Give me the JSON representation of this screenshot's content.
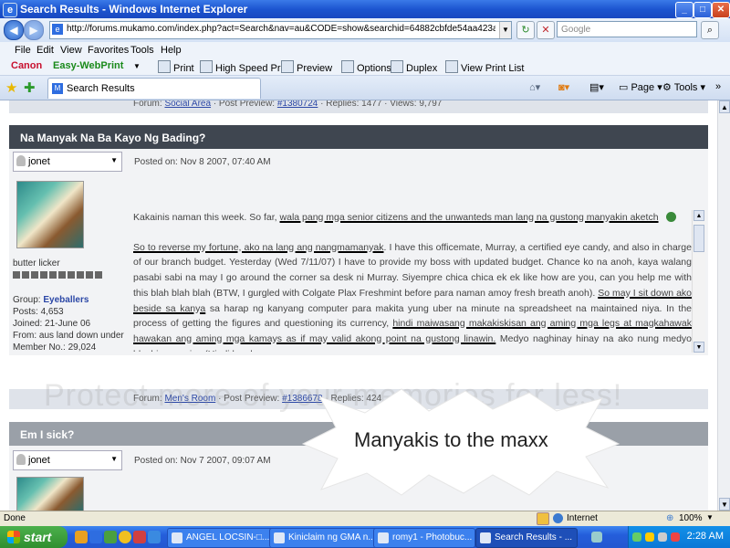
{
  "window": {
    "title": "Search Results - Windows Internet Explorer",
    "minimize": "_",
    "maximize": "□",
    "close": "✕"
  },
  "address": {
    "url": "http://forums.mukamo.com/index.php?act=Search&nav=au&CODE=show&searchid=64882cbfde54aa423ab0834bec87c23",
    "search_placeholder": "Google"
  },
  "menu": [
    "File",
    "Edit",
    "View",
    "Favorites",
    "Tools",
    "Help"
  ],
  "canon_toolbar": {
    "brand": "Canon",
    "product": "Easy-WebPrint",
    "buttons": [
      "Print",
      "High Speed Print",
      "Preview",
      "Options",
      "Duplex",
      "View Print List"
    ]
  },
  "tab": {
    "label": "Search Results"
  },
  "command_bar": {
    "page": "Page",
    "tools": "Tools"
  },
  "prev_post_footer": {
    "prefix": "Forum:",
    "forum": "Social Area",
    "mid": "· Post Preview:",
    "post": "#1380724",
    "rest": "· Replies: 1477 · Views: 9,797"
  },
  "post1": {
    "title": "Na Manyak Na Ba Kayo Ng Bading?",
    "user": "jonet",
    "posted": "Posted on: Nov 8 2007, 07:40 AM",
    "rank_title": "butter licker",
    "group_label": "Group:",
    "group": "Eyeballers",
    "posts": "Posts: 4,653",
    "joined": "Joined: 21-June 06",
    "from": "From: aus land down under",
    "member_no": "Member No.: 29,024",
    "body": {
      "p1_a": "Kakainis naman this week. So far,",
      "p1_b": "wala pang mga senior citizens and the unwanteds man lang na gustong manyakin aketch",
      "p2_a": "So to reverse my fortune, ako na lang ang nangmamanyak",
      "p2_b": ". I have this officemate, Murray, a certified eye candy, and also in charge of our branch budget. Yesterday (Wed 7/11/07) I have to provide my boss with updated budget. Chance ko na anoh, kaya walang pasabi sabi na may I go around the corner sa desk ni Murray. Siyempre chica chica ek ek like how are you, can you help me with this blah blah blah (BTW, I gurgled with Colgate Plax Freshmint before para naman amoy fresh breath anoh).",
      "p2_c": "So may I sit down ako beside sa kanya",
      "p2_d": "sa harap ng kanyang computer para makita yung uber na minute na spreadsheet na maintained niya. In the process of getting the figures and questioning its currency,",
      "p2_e": "hindi maiwasang makakiskisan ang aming mga legs at magkahawak hawakan ang aming mga kamays as if may valid akong point na gustong linawin.",
      "p2_f": "Medyo naghinay hinay na ako nung medyo blushing na siya (Hindi ko alam"
    }
  },
  "post1_footer": {
    "prefix": "Forum:",
    "forum": "Men's Room",
    "mid": "· Post Preview:",
    "post": "#1386678",
    "rest": "· Replies: 424"
  },
  "post2": {
    "title": "Em I sick?",
    "user": "jonet",
    "posted": "Posted on: Nov 7 2007, 09:07 AM"
  },
  "watermark": "Protect more of your memories for less!",
  "overlay_caption": "Manyakis to the maxx",
  "statusbar": {
    "status": "Done",
    "zone": "Internet",
    "zoom": "100%"
  },
  "taskbar": {
    "start": "start",
    "tasks": [
      "ANGEL LOCSIN-□...",
      "Kiniclaim ng GMA n...",
      "romy1 - Photobuc...",
      "Search Results - ..."
    ],
    "clock": "2:28 AM"
  },
  "colors": {
    "title_blue": "#1c55d0",
    "post_header": "#3f4650",
    "taskbar_blue": "#245edb",
    "start_green": "#2f8f2f",
    "link": "#2b47a6"
  }
}
